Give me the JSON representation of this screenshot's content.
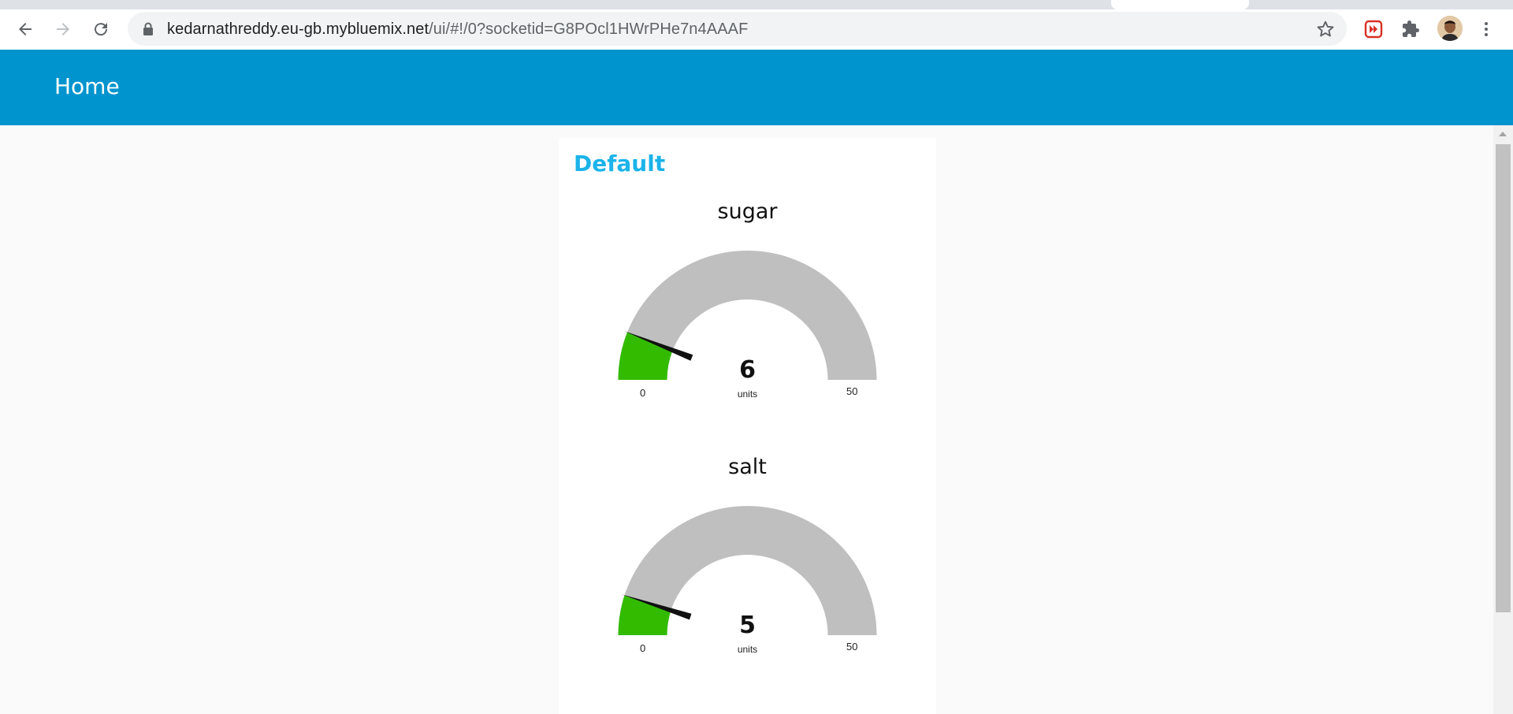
{
  "browser": {
    "url_host": "kedarnathreddy.eu-gb.mybluemix.net",
    "url_path": "/ui/#!/0?socketid=G8POcl1HWrPHe7n4AAAF",
    "icons": [
      "back-icon",
      "forward-icon",
      "reload-icon",
      "lock-icon",
      "star-icon",
      "extension-icon",
      "puzzle-icon",
      "menu-icon"
    ]
  },
  "header": {
    "title": "Home",
    "color": "#0094ce"
  },
  "group": {
    "title": "Default",
    "title_color": "#1bb3ea"
  },
  "gauges": [
    {
      "label": "sugar",
      "value": "6",
      "units": "units",
      "min": "0",
      "max": "50",
      "fill_fraction": 0.12,
      "fill_color": "#33bb00",
      "track_color": "#bfbfbf"
    },
    {
      "label": "salt",
      "value": "5",
      "units": "units",
      "min": "0",
      "max": "50",
      "fill_fraction": 0.1,
      "fill_color": "#33bb00",
      "track_color": "#bfbfbf"
    }
  ]
}
